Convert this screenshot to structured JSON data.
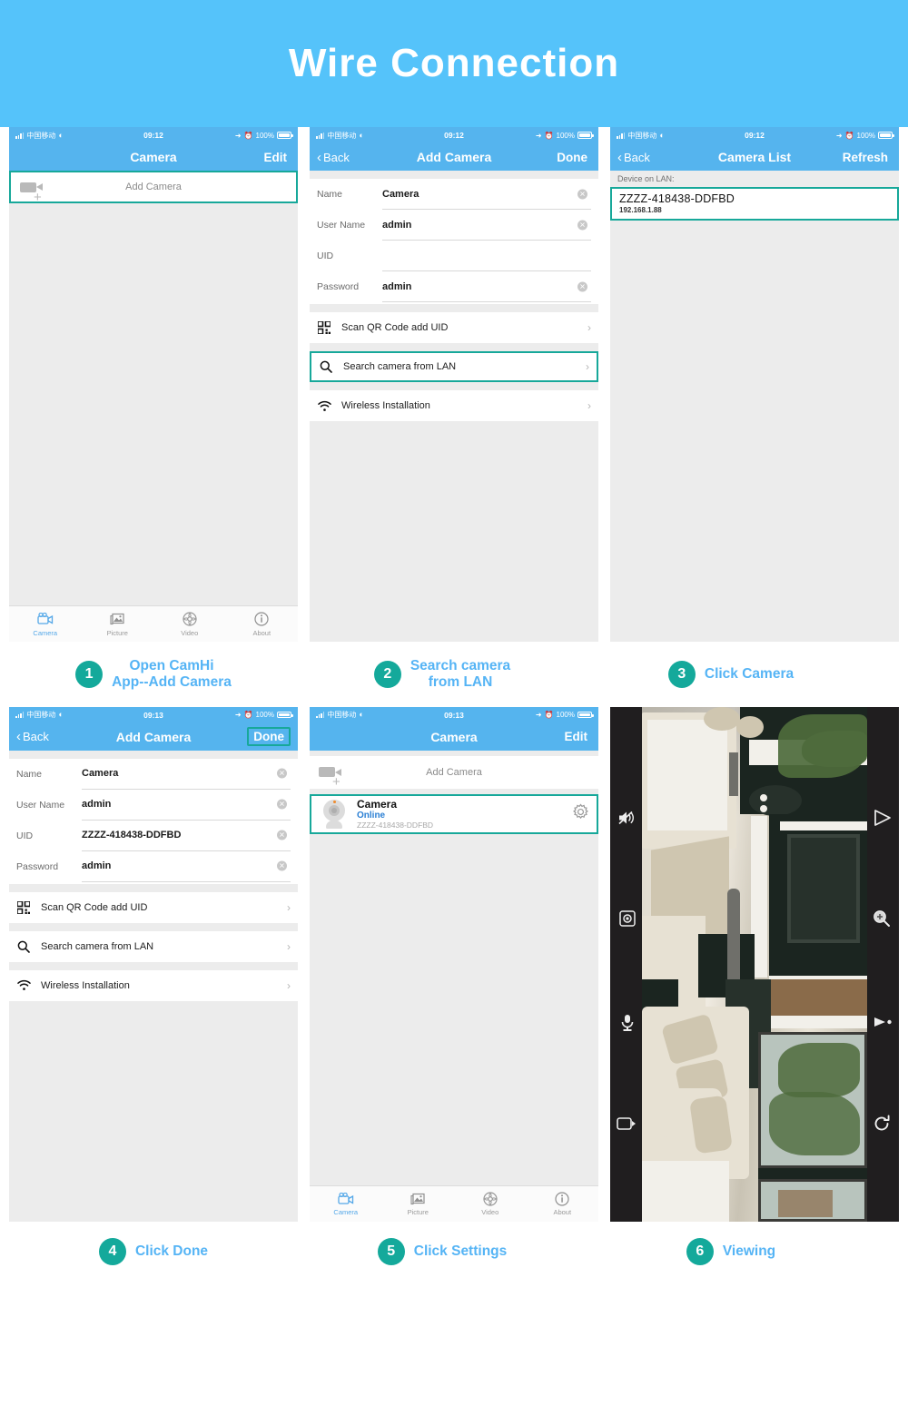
{
  "banner": {
    "title": "Wire Connection"
  },
  "statusbar": {
    "carrier": "中国移动",
    "wifi_icon": "wifi-icon",
    "time_1": "09:12",
    "time_2": "09:13",
    "battery_percent": "100%",
    "location_icon": "location-arrow-icon",
    "alarm_icon": "alarm-clock-icon"
  },
  "colors": {
    "banner_bg": "#55c3fa",
    "navbar_bg": "#55b4ee",
    "accent_teal": "#14a99b",
    "caption_blue": "#55b4f5",
    "online_blue": "#2a7fd4"
  },
  "panel1": {
    "nav": {
      "title": "Camera",
      "right": "Edit"
    },
    "add_camera_label": "Add Camera",
    "tabs": [
      {
        "label": "Camera",
        "icon": "video-camera-icon",
        "active": true
      },
      {
        "label": "Picture",
        "icon": "photo-icon",
        "active": false
      },
      {
        "label": "Video",
        "icon": "video-disc-icon",
        "active": false
      },
      {
        "label": "About",
        "icon": "info-circle-icon",
        "active": false
      }
    ]
  },
  "panel2": {
    "nav": {
      "back": "Back",
      "title": "Add Camera",
      "right": "Done"
    },
    "form": [
      {
        "label": "Name",
        "value": "Camera"
      },
      {
        "label": "User Name",
        "value": "admin"
      },
      {
        "label": "UID",
        "value": ""
      },
      {
        "label": "Password",
        "value": "admin"
      }
    ],
    "actions": [
      {
        "label": "Scan QR Code add UID",
        "icon": "qr-code-icon",
        "highlight": false
      },
      {
        "label": "Search camera from LAN",
        "icon": "search-icon",
        "highlight": true
      },
      {
        "label": "Wireless Installation",
        "icon": "wifi-icon",
        "highlight": false
      }
    ]
  },
  "panel3": {
    "nav": {
      "back": "Back",
      "title": "Camera List",
      "right": "Refresh"
    },
    "section_label": "Device on LAN:",
    "device": {
      "uid": "ZZZZ-418438-DDFBD",
      "ip": "192.168.1.88"
    }
  },
  "panel4": {
    "nav": {
      "back": "Back",
      "title": "Add Camera",
      "right": "Done"
    },
    "form": [
      {
        "label": "Name",
        "value": "Camera"
      },
      {
        "label": "User Name",
        "value": "admin"
      },
      {
        "label": "UID",
        "value": "ZZZZ-418438-DDFBD"
      },
      {
        "label": "Password",
        "value": "admin"
      }
    ],
    "actions": [
      {
        "label": "Scan QR Code add UID",
        "icon": "qr-code-icon"
      },
      {
        "label": "Search camera from LAN",
        "icon": "search-icon"
      },
      {
        "label": "Wireless Installation",
        "icon": "wifi-icon"
      }
    ]
  },
  "panel5": {
    "nav": {
      "title": "Camera",
      "right": "Edit"
    },
    "add_camera_label": "Add Camera",
    "device": {
      "name": "Camera",
      "status": "Online",
      "uid": "ZZZZ-418438-DDFBD",
      "settings_icon": "gear-icon"
    },
    "tabs": [
      {
        "label": "Camera",
        "icon": "video-camera-icon",
        "active": true
      },
      {
        "label": "Picture",
        "icon": "photo-icon",
        "active": false
      },
      {
        "label": "Video",
        "icon": "video-disc-icon",
        "active": false
      },
      {
        "label": "About",
        "icon": "info-circle-icon",
        "active": false
      }
    ]
  },
  "panel6": {
    "controls": [
      {
        "name": "mute-speaker-icon",
        "position": "left-top"
      },
      {
        "name": "snapshot-icon",
        "position": "left-mid"
      },
      {
        "name": "microphone-icon",
        "position": "left-low"
      },
      {
        "name": "fullscreen-icon",
        "position": "left-bottom"
      },
      {
        "name": "play-icon",
        "position": "right-top"
      },
      {
        "name": "zoom-in-icon",
        "position": "right-mid"
      },
      {
        "name": "record-icon",
        "position": "right-low"
      },
      {
        "name": "rotate-icon",
        "position": "right-bottom"
      }
    ]
  },
  "steps": [
    {
      "num": "1",
      "text": "Open CamHi\nApp--Add Camera"
    },
    {
      "num": "2",
      "text": "Search camera\nfrom LAN"
    },
    {
      "num": "3",
      "text": "Click Camera"
    },
    {
      "num": "4",
      "text": "Click Done"
    },
    {
      "num": "5",
      "text": "Click Settings"
    },
    {
      "num": "6",
      "text": "Viewing"
    }
  ]
}
